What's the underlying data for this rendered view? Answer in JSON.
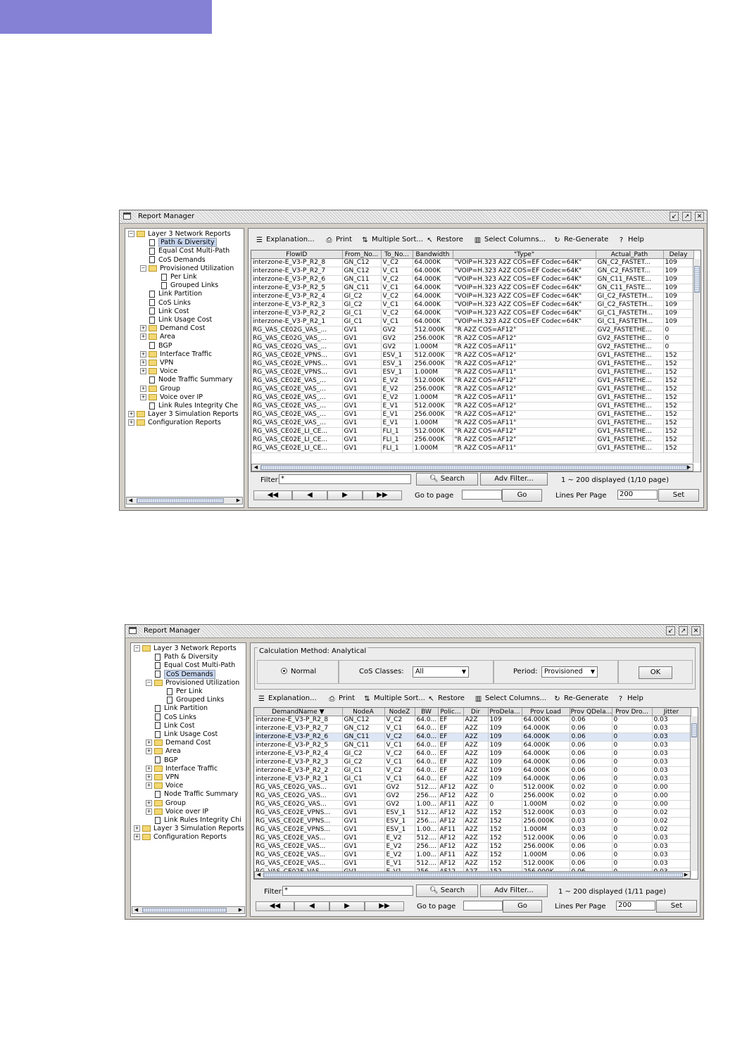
{
  "window": {
    "title": "Report Manager",
    "buttons": [
      "↙",
      "↗",
      "✕"
    ]
  },
  "tree": {
    "items": [
      {
        "label": "Layer 3 Network Reports",
        "expander": "−",
        "kind": "folder",
        "level": 0
      },
      {
        "label": "Path & Diversity",
        "kind": "doc",
        "level": 1
      },
      {
        "label": "Equal Cost Multi-Path",
        "kind": "doc",
        "level": 1
      },
      {
        "label": "CoS Demands",
        "kind": "doc",
        "level": 1
      },
      {
        "label": "Provisioned Utilization",
        "expander": "−",
        "kind": "folder",
        "level": 1
      },
      {
        "label": "Per Link",
        "kind": "doc",
        "level": 2
      },
      {
        "label": "Grouped Links",
        "kind": "doc",
        "level": 2
      },
      {
        "label": "Link Partition",
        "kind": "doc",
        "level": 1
      },
      {
        "label": "CoS Links",
        "kind": "doc",
        "level": 1
      },
      {
        "label": "Link Cost",
        "kind": "doc",
        "level": 1
      },
      {
        "label": "Link Usage Cost",
        "kind": "doc",
        "level": 1
      },
      {
        "label": "Demand Cost",
        "expander": "+",
        "kind": "folder",
        "level": 1
      },
      {
        "label": "Area",
        "expander": "+",
        "kind": "folder",
        "level": 1
      },
      {
        "label": "BGP",
        "kind": "doc",
        "level": 1
      },
      {
        "label": "Interface Traffic",
        "expander": "+",
        "kind": "folder",
        "level": 1
      },
      {
        "label": "VPN",
        "expander": "+",
        "kind": "folder",
        "level": 1
      },
      {
        "label": "Voice",
        "expander": "+",
        "kind": "folder",
        "level": 1
      },
      {
        "label": "Node Traffic Summary",
        "kind": "doc",
        "level": 1
      },
      {
        "label": "Group",
        "expander": "+",
        "kind": "folder",
        "level": 1
      },
      {
        "label": "Voice over IP",
        "expander": "+",
        "kind": "folder",
        "level": 1
      },
      {
        "label": "Link Rules Integrity Che",
        "kind": "doc",
        "level": 1
      },
      {
        "label": "Layer 3 Simulation Reports",
        "expander": "+",
        "kind": "folder",
        "level": 0
      },
      {
        "label": "Configuration Reports",
        "expander": "+",
        "kind": "folder",
        "level": 0
      }
    ],
    "items2_last": "Link Rules Integrity Chi"
  },
  "toolbar": {
    "explanation": "Explanation...",
    "print": "Print",
    "multiple_sort": "Multiple Sort...",
    "restore": "Restore",
    "select_columns": "Select Columns...",
    "regenerate": "Re-Generate",
    "help": "Help",
    "icons": {
      "explanation": "☰",
      "print": "⎙",
      "multiple_sort": "⇅",
      "restore": "↖",
      "select_columns": "▥",
      "regenerate": "↻",
      "help": "?"
    }
  },
  "report1": {
    "selected_tree_item": "Path & Diversity",
    "columns": [
      "FlowID",
      "From_No...",
      "To_No...",
      "Bandwidth",
      "\"Type\"",
      "Actual_Path",
      "Delay"
    ],
    "rows": [
      [
        "interzone-E_V3-P_R2_8",
        "GN_C12",
        "V_C2",
        "64.000K",
        "\"VOIP=H.323 A2Z COS=EF Codec=64K\"",
        "GN_C2_FASTET...",
        "109"
      ],
      [
        "interzone-E_V3-P_R2_7",
        "GN_C12",
        "V_C1",
        "64.000K",
        "\"VOIP=H.323 A2Z COS=EF Codec=64K\"",
        "GN_C2_FASTET...",
        "109"
      ],
      [
        "interzone-E_V3-P_R2_6",
        "GN_C11",
        "V_C2",
        "64.000K",
        "\"VOIP=H.323 A2Z COS=EF Codec=64K\"",
        "GN_C11_FASTE...",
        "109"
      ],
      [
        "interzone-E_V3-P_R2_5",
        "GN_C11",
        "V_C1",
        "64.000K",
        "\"VOIP=H.323 A2Z COS=EF Codec=64K\"",
        "GN_C11_FASTE...",
        "109"
      ],
      [
        "interzone-E_V3-P_R2_4",
        "GI_C2",
        "V_C2",
        "64.000K",
        "\"VOIP=H.323 A2Z COS=EF Codec=64K\"",
        "GI_C2_FASTETH...",
        "109"
      ],
      [
        "interzone-E_V3-P_R2_3",
        "GI_C2",
        "V_C1",
        "64.000K",
        "\"VOIP=H.323 A2Z COS=EF Codec=64K\"",
        "GI_C2_FASTETH...",
        "109"
      ],
      [
        "interzone-E_V3-P_R2_2",
        "GI_C1",
        "V_C2",
        "64.000K",
        "\"VOIP=H.323 A2Z COS=EF Codec=64K\"",
        "GI_C1_FASTETH...",
        "109"
      ],
      [
        "interzone-E_V3-P_R2_1",
        "GI_C1",
        "V_C1",
        "64.000K",
        "\"VOIP=H.323 A2Z COS=EF Codec=64K\"",
        "GI_C1_FASTETH...",
        "109"
      ],
      [
        "RG_VAS_CE02G_VAS_...",
        "GV1",
        "GV2",
        "512.000K",
        "\"R A2Z COS=AF12\"",
        "GV2_FASTETHE...",
        "0"
      ],
      [
        "RG_VAS_CE02G_VAS_...",
        "GV1",
        "GV2",
        "256.000K",
        "\"R A2Z COS=AF12\"",
        "GV2_FASTETHE...",
        "0"
      ],
      [
        "RG_VAS_CE02G_VAS_...",
        "GV1",
        "GV2",
        "1.000M",
        "\"R A2Z COS=AF11\"",
        "GV2_FASTETHE...",
        "0"
      ],
      [
        "RG_VAS_CE02E_VPNS...",
        "GV1",
        "ESV_1",
        "512.000K",
        "\"R A2Z COS=AF12\"",
        "GV1_FASTETHE...",
        "152"
      ],
      [
        "RG_VAS_CE02E_VPNS...",
        "GV1",
        "ESV_1",
        "256.000K",
        "\"R A2Z COS=AF12\"",
        "GV1_FASTETHE...",
        "152"
      ],
      [
        "RG_VAS_CE02E_VPNS...",
        "GV1",
        "ESV_1",
        "1.000M",
        "\"R A2Z COS=AF11\"",
        "GV1_FASTETHE...",
        "152"
      ],
      [
        "RG_VAS_CE02E_VAS_...",
        "GV1",
        "E_V2",
        "512.000K",
        "\"R A2Z COS=AF12\"",
        "GV1_FASTETHE...",
        "152"
      ],
      [
        "RG_VAS_CE02E_VAS_...",
        "GV1",
        "E_V2",
        "256.000K",
        "\"R A2Z COS=AF12\"",
        "GV1_FASTETHE...",
        "152"
      ],
      [
        "RG_VAS_CE02E_VAS_...",
        "GV1",
        "E_V2",
        "1.000M",
        "\"R A2Z COS=AF11\"",
        "GV1_FASTETHE...",
        "152"
      ],
      [
        "RG_VAS_CE02E_VAS_...",
        "GV1",
        "E_V1",
        "512.000K",
        "\"R A2Z COS=AF12\"",
        "GV1_FASTETHE...",
        "152"
      ],
      [
        "RG_VAS_CE02E_VAS_...",
        "GV1",
        "E_V1",
        "256.000K",
        "\"R A2Z COS=AF12\"",
        "GV1_FASTETHE...",
        "152"
      ],
      [
        "RG_VAS_CE02E_VAS_...",
        "GV1",
        "E_V1",
        "1.000M",
        "\"R A2Z COS=AF11\"",
        "GV1_FASTETHE...",
        "152"
      ],
      [
        "RG_VAS_CE02E_LI_CE...",
        "GV1",
        "FLI_1",
        "512.000K",
        "\"R A2Z COS=AF12\"",
        "GV1_FASTETHE...",
        "152"
      ],
      [
        "RG_VAS_CE02E_LI_CE...",
        "GV1",
        "FLI_1",
        "256.000K",
        "\"R A2Z COS=AF12\"",
        "GV1_FASTETHE...",
        "152"
      ],
      [
        "RG_VAS_CE02E_LI_CE...",
        "GV1",
        "FLI_1",
        "1.000M",
        "\"R A2Z COS=AF11\"",
        "GV1_FASTETHE...",
        "152"
      ]
    ],
    "filter_label": "Filter:",
    "filter_value": "*",
    "search": "Search",
    "adv_filter": "Adv Filter...",
    "displayed": "1 ~ 200 displayed (1/10 page)",
    "goto_label": "Go to page",
    "go": "Go",
    "lines_label": "Lines Per Page",
    "lines_value": "200",
    "set": "Set",
    "nav": [
      "◀◀",
      "◀",
      "▶",
      "▶▶"
    ]
  },
  "report2": {
    "selected_tree_item": "CoS Demands",
    "calc_legend": "Calculation Method: Analytical",
    "normal": "Normal",
    "cos_classes_label": "CoS Classes:",
    "cos_classes_value": "All",
    "period_label": "Period:",
    "period_value": "Provisioned",
    "ok": "OK",
    "columns": [
      "DemandName ▼",
      "NodeA",
      "NodeZ",
      "BW",
      "Polic...",
      "Dir",
      "ProDela...",
      "Prov   Load",
      "Prov QDela...",
      "Prov Dro...",
      "Jitter"
    ],
    "rows": [
      [
        "interzone-E_V3-P_R2_8",
        "GN_C12",
        "V_C2",
        "64.0...",
        "EF",
        "A2Z",
        "109",
        "64.000K",
        "0.06",
        "0",
        "0.03"
      ],
      [
        "interzone-E_V3-P_R2_7",
        "GN_C12",
        "V_C1",
        "64.0...",
        "EF",
        "A2Z",
        "109",
        "64.000K",
        "0.06",
        "0",
        "0.03"
      ],
      [
        "interzone-E_V3-P_R2_6",
        "GN_C11",
        "V_C2",
        "64.0...",
        "EF",
        "A2Z",
        "109",
        "64.000K",
        "0.06",
        "0",
        "0.03"
      ],
      [
        "interzone-E_V3-P_R2_5",
        "GN_C11",
        "V_C1",
        "64.0...",
        "EF",
        "A2Z",
        "109",
        "64.000K",
        "0.06",
        "0",
        "0.03"
      ],
      [
        "interzone-E_V3-P_R2_4",
        "GI_C2",
        "V_C2",
        "64.0...",
        "EF",
        "A2Z",
        "109",
        "64.000K",
        "0.06",
        "0",
        "0.03"
      ],
      [
        "interzone-E_V3-P_R2_3",
        "GI_C2",
        "V_C1",
        "64.0...",
        "EF",
        "A2Z",
        "109",
        "64.000K",
        "0.06",
        "0",
        "0.03"
      ],
      [
        "interzone-E_V3-P_R2_2",
        "GI_C1",
        "V_C2",
        "64.0...",
        "EF",
        "A2Z",
        "109",
        "64.000K",
        "0.06",
        "0",
        "0.03"
      ],
      [
        "interzone-E_V3-P_R2_1",
        "GI_C1",
        "V_C1",
        "64.0...",
        "EF",
        "A2Z",
        "109",
        "64.000K",
        "0.06",
        "0",
        "0.03"
      ],
      [
        "RG_VAS_CE02G_VAS...",
        "GV1",
        "GV2",
        "512....",
        "AF12",
        "A2Z",
        "0",
        "512.000K",
        "0.02",
        "0",
        "0.00"
      ],
      [
        "RG_VAS_CE02G_VAS...",
        "GV1",
        "GV2",
        "256....",
        "AF12",
        "A2Z",
        "0",
        "256.000K",
        "0.02",
        "0",
        "0.00"
      ],
      [
        "RG_VAS_CE02G_VAS...",
        "GV1",
        "GV2",
        "1.00...",
        "AF11",
        "A2Z",
        "0",
        "1.000M",
        "0.02",
        "0",
        "0.00"
      ],
      [
        "RG_VAS_CE02E_VPNS...",
        "GV1",
        "ESV_1",
        "512....",
        "AF12",
        "A2Z",
        "152",
        "512.000K",
        "0.03",
        "0",
        "0.02"
      ],
      [
        "RG_VAS_CE02E_VPNS...",
        "GV1",
        "ESV_1",
        "256....",
        "AF12",
        "A2Z",
        "152",
        "256.000K",
        "0.03",
        "0",
        "0.02"
      ],
      [
        "RG_VAS_CE02E_VPNS...",
        "GV1",
        "ESV_1",
        "1.00...",
        "AF11",
        "A2Z",
        "152",
        "1.000M",
        "0.03",
        "0",
        "0.02"
      ],
      [
        "RG_VAS_CE02E_VAS...",
        "GV1",
        "E_V2",
        "512....",
        "AF12",
        "A2Z",
        "152",
        "512.000K",
        "0.06",
        "0",
        "0.03"
      ],
      [
        "RG_VAS_CE02E_VAS...",
        "GV1",
        "E_V2",
        "256....",
        "AF12",
        "A2Z",
        "152",
        "256.000K",
        "0.06",
        "0",
        "0.03"
      ],
      [
        "RG_VAS_CE02E_VAS...",
        "GV1",
        "E_V2",
        "1.00...",
        "AF11",
        "A2Z",
        "152",
        "1.000M",
        "0.06",
        "0",
        "0.03"
      ],
      [
        "RG_VAS_CE02E_VAS...",
        "GV1",
        "E_V1",
        "512....",
        "AF12",
        "A2Z",
        "152",
        "512.000K",
        "0.06",
        "0",
        "0.03"
      ],
      [
        "RG_VAS_CE02E_VAS...",
        "GV1",
        "E_V1",
        "256....",
        "AF12",
        "A2Z",
        "152",
        "256.000K",
        "0.06",
        "0",
        "0.03"
      ]
    ],
    "highlight_row": 2,
    "filter_label": "Filter:",
    "filter_value": "*",
    "search": "Search",
    "adv_filter": "Adv Filter...",
    "displayed": "1 ~ 200 displayed (1/11 page)",
    "goto_label": "Go to page",
    "go": "Go",
    "lines_label": "Lines Per Page",
    "lines_value": "200",
    "set": "Set",
    "nav": [
      "◀◀",
      "◀",
      "▶",
      "▶▶"
    ]
  }
}
